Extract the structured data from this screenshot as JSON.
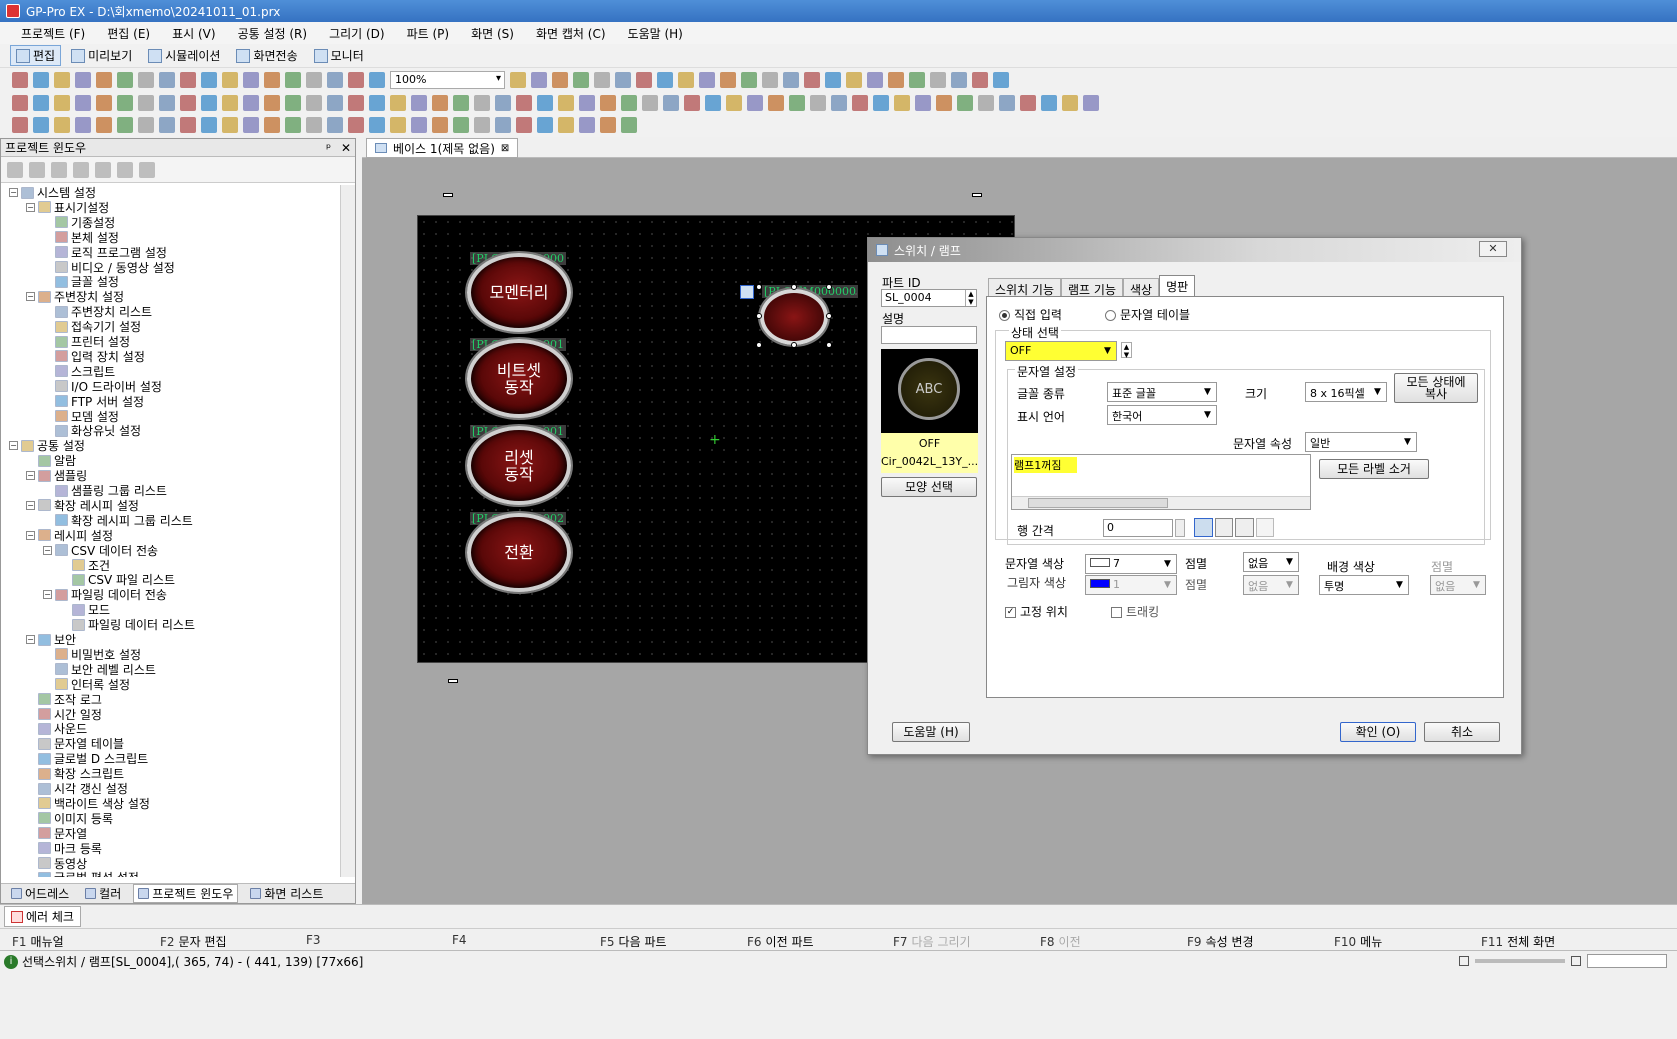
{
  "window": {
    "title": "GP-Pro EX - D:\\회xmemo\\20241011_01.prx"
  },
  "menu": [
    "프로젝트 (F)",
    "편집 (E)",
    "표시 (V)",
    "공통 설정 (R)",
    "그리기 (D)",
    "파트 (P)",
    "화면 (S)",
    "화면 캡처 (C)",
    "도움말 (H)"
  ],
  "modes": [
    "편집",
    "미리보기",
    "시뮬레이션",
    "화면전송",
    "모니터"
  ],
  "zoom": "100%",
  "project_window": {
    "title": "프로젝트 윈도우",
    "pin": "ᵖ",
    "close": "✕",
    "tree": [
      {
        "label": "시스템 설정",
        "level": 0,
        "exp": "−"
      },
      {
        "label": "표시기설정",
        "level": 1,
        "exp": "−"
      },
      {
        "label": "기종설정",
        "level": 2
      },
      {
        "label": "본체 설정",
        "level": 2
      },
      {
        "label": "로직 프로그램 설정",
        "level": 2
      },
      {
        "label": "비디오 / 동영상 설정",
        "level": 2
      },
      {
        "label": "글꼴 설정",
        "level": 2
      },
      {
        "label": "주변장치 설정",
        "level": 1,
        "exp": "−"
      },
      {
        "label": "주변장치 리스트",
        "level": 2
      },
      {
        "label": "접속기기 설정",
        "level": 2
      },
      {
        "label": "프린터 설정",
        "level": 2
      },
      {
        "label": "입력 장치 설정",
        "level": 2
      },
      {
        "label": "스크립트",
        "level": 2
      },
      {
        "label": "I/O 드라이버 설정",
        "level": 2
      },
      {
        "label": "FTP 서버 설정",
        "level": 2
      },
      {
        "label": "모뎀 설정",
        "level": 2
      },
      {
        "label": "화상유닛 설정",
        "level": 2
      },
      {
        "label": "공통 설정",
        "level": 0,
        "exp": "−"
      },
      {
        "label": "알람",
        "level": 1
      },
      {
        "label": "샘플링",
        "level": 1,
        "exp": "−"
      },
      {
        "label": "샘플링 그룹 리스트",
        "level": 2
      },
      {
        "label": "확장 레시피 설정",
        "level": 1,
        "exp": "−"
      },
      {
        "label": "확장 레시피 그룹 리스트",
        "level": 2
      },
      {
        "label": "레시피 설정",
        "level": 1,
        "exp": "−"
      },
      {
        "label": "CSV 데이터 전송",
        "level": 2,
        "exp": "−"
      },
      {
        "label": "조건",
        "level": 3
      },
      {
        "label": "CSV 파일 리스트",
        "level": 3
      },
      {
        "label": "파일링 데이터 전송",
        "level": 2,
        "exp": "−"
      },
      {
        "label": "모드",
        "level": 3
      },
      {
        "label": "파일링 데이터 리스트",
        "level": 3
      },
      {
        "label": "보안",
        "level": 1,
        "exp": "−"
      },
      {
        "label": "비밀번호 설정",
        "level": 2
      },
      {
        "label": "보안 레벨 리스트",
        "level": 2
      },
      {
        "label": "인터록 설정",
        "level": 2
      },
      {
        "label": "조작 로그",
        "level": 1
      },
      {
        "label": "시간 일정",
        "level": 1
      },
      {
        "label": "사운드",
        "level": 1
      },
      {
        "label": "문자열 테이블",
        "level": 1
      },
      {
        "label": "글로벌 D 스크립트",
        "level": 1
      },
      {
        "label": "확장 스크립트",
        "level": 1
      },
      {
        "label": "시각 갱신 설정",
        "level": 1
      },
      {
        "label": "백라이트 색상 설정",
        "level": 1
      },
      {
        "label": "이미지 등록",
        "level": 1
      },
      {
        "label": "문자열",
        "level": 1
      },
      {
        "label": "마크 등록",
        "level": 1
      },
      {
        "label": "동영상",
        "level": 1
      },
      {
        "label": "글로벌 평석 설정",
        "level": 1
      }
    ],
    "tabs": [
      "어드레스",
      "컬러",
      "프로젝트 윈도우",
      "화면 리스트"
    ]
  },
  "editor": {
    "tab_label": "베이스 1(제목 없음)",
    "buttons": [
      {
        "tag": "[PLC1]M000000",
        "label": "모멘터리"
      },
      {
        "tag": "[PLC1]M000001",
        "label": "비트셋\n동작"
      },
      {
        "tag": "[PLC1]M000001",
        "label": "리셋\n동작"
      },
      {
        "tag": "[PLC1]M000002",
        "label": "전환"
      }
    ],
    "lamp_tag": "[PLC1]M000000"
  },
  "dialog": {
    "title": "스위치 / 램프",
    "close": "✕",
    "part_id_label": "파트 ID",
    "part_id": "SL_0004",
    "desc_label": "설명",
    "desc": "",
    "preview_text": "ABC",
    "preview_state": "OFF",
    "preview_shape": "Cir_0042L_13Y_...",
    "shape_button": "모양 선택",
    "tabs": [
      "스위치 기능",
      "램프 기능",
      "색상",
      "명판"
    ],
    "active_tab": "명판",
    "radio_direct": "직접 입력",
    "radio_table": "문자열 테이블",
    "state_label": "상태 선택",
    "state_value": "OFF",
    "str_settings_label": "문자열 설정",
    "font_type_label": "글꼴 종류",
    "font_type": "표준 글꼴",
    "size_label": "크기",
    "size": "8 x 16픽셀",
    "copy_all_button": "모든 상태에\n복사",
    "lang_label": "표시 언어",
    "lang": "한국어",
    "str_attr_label": "문자열 속성",
    "str_attr": "일반",
    "label_text": "램프1꺼짐",
    "clear_labels_button": "모든 라벨 소거",
    "line_spacing_label": "행 간격",
    "line_spacing": "0",
    "text_color_label": "문자열 색상",
    "text_color": "7",
    "shadow_color_label": "그림자 색상",
    "shadow_color": "1",
    "blink_label": "점멸",
    "blink1": "없음",
    "blink2": "없음",
    "bg_color_label": "배경 색상",
    "bg_color": "투명",
    "blink3_label": "점멸",
    "blink3": "없음",
    "fixed_pos_label": "고정 위치",
    "tracking_label": "트래킹",
    "help_button": "도움말 (H)",
    "ok_button": "확인 (O)",
    "cancel_button": "취소"
  },
  "error_check": "에러 체크",
  "fkeys": [
    {
      "key": "F1",
      "label": "매뉴얼",
      "enabled": true
    },
    {
      "key": "F2",
      "label": "문자 편집",
      "enabled": true
    },
    {
      "key": "F3",
      "label": "",
      "enabled": false
    },
    {
      "key": "F4",
      "label": "",
      "enabled": false
    },
    {
      "key": "F5",
      "label": "다음 파트",
      "enabled": true
    },
    {
      "key": "F6",
      "label": "이전 파트",
      "enabled": true
    },
    {
      "key": "F7",
      "label": "다음 그리기",
      "enabled": false
    },
    {
      "key": "F8",
      "label": "이전",
      "enabled": false
    },
    {
      "key": "F9",
      "label": "속성 변경",
      "enabled": true
    },
    {
      "key": "F10",
      "label": "메뉴",
      "enabled": true
    },
    {
      "key": "F11",
      "label": "전체 화면",
      "enabled": true
    }
  ],
  "status": "선택스위치 / 램프[SL_0004],( 365,  74) - ( 441, 139) [77x66]",
  "colors": {
    "titlebar": "#3572c2",
    "canvas": "#000000",
    "highlight": "#ffff33",
    "screen_bg": "#a6a6a6"
  }
}
